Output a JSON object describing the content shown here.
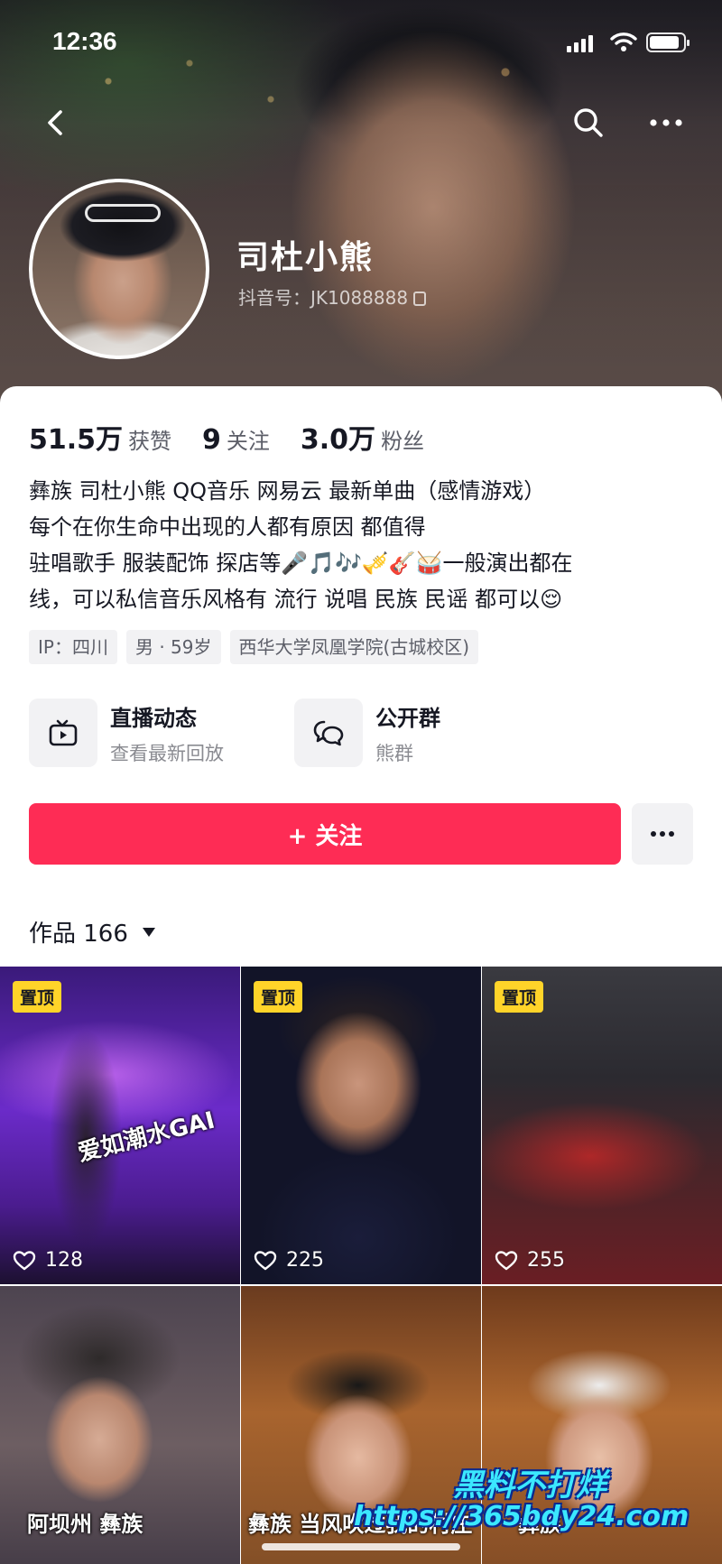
{
  "status_bar": {
    "time": "12:36",
    "battery_level_pct": 90
  },
  "nav": {
    "back_icon": "chevron-left-icon",
    "search_icon": "search-icon",
    "more_icon": "ellipsis-icon"
  },
  "profile": {
    "nickname": "司杜小熊",
    "douyin_id": "抖音号：JK1088888"
  },
  "stats": [
    {
      "value": "51.5万",
      "label": "获赞"
    },
    {
      "value": "9",
      "label": "关注"
    },
    {
      "value": "3.0万",
      "label": "粉丝"
    }
  ],
  "bio": [
    "彝族 司杜小熊 QQ音乐 网易云 最新单曲（感情游戏）",
    "每个在你生命中出现的人都有原因  都值得",
    "驻唱歌手 服装配饰  探店等🎤🎵🎶🎺🎸🥁一般演出都在",
    "线，可以私信音乐风格有 流行 说唱 民族  民谣 都可以😌"
  ],
  "tags": [
    "IP：四川",
    "男 · 59岁",
    "西华大学凤凰学院(古城校区)"
  ],
  "entries": [
    {
      "title": "直播动态",
      "subtitle": "查看最新回放",
      "icon": "tv-icon"
    },
    {
      "title": "公开群",
      "subtitle": "熊群",
      "icon": "group-chat-icon"
    }
  ],
  "actions": {
    "follow_label": "+ 关注"
  },
  "works": {
    "tab_label": "作品 166"
  },
  "videos": [
    {
      "pinned_label": "置顶",
      "likes": "128",
      "caption": "爱如潮水GAI"
    },
    {
      "pinned_label": "置顶",
      "likes": "225",
      "caption": ""
    },
    {
      "pinned_label": "置顶",
      "likes": "255",
      "caption": ""
    },
    {
      "pinned_label": "",
      "likes": "",
      "caption": "阿坝州 彝族"
    },
    {
      "pinned_label": "",
      "likes": "",
      "caption": "彝族 当风吹过我的村庄"
    },
    {
      "pinned_label": "",
      "likes": "",
      "caption": "彝族"
    }
  ],
  "watermark": {
    "line1": "黑料不打烊",
    "line2": "https://365bdy24.com"
  },
  "colors": {
    "accent": "#fe2c55",
    "pin": "#ffd429",
    "text": "#161823",
    "muted": "#5c5e68"
  }
}
